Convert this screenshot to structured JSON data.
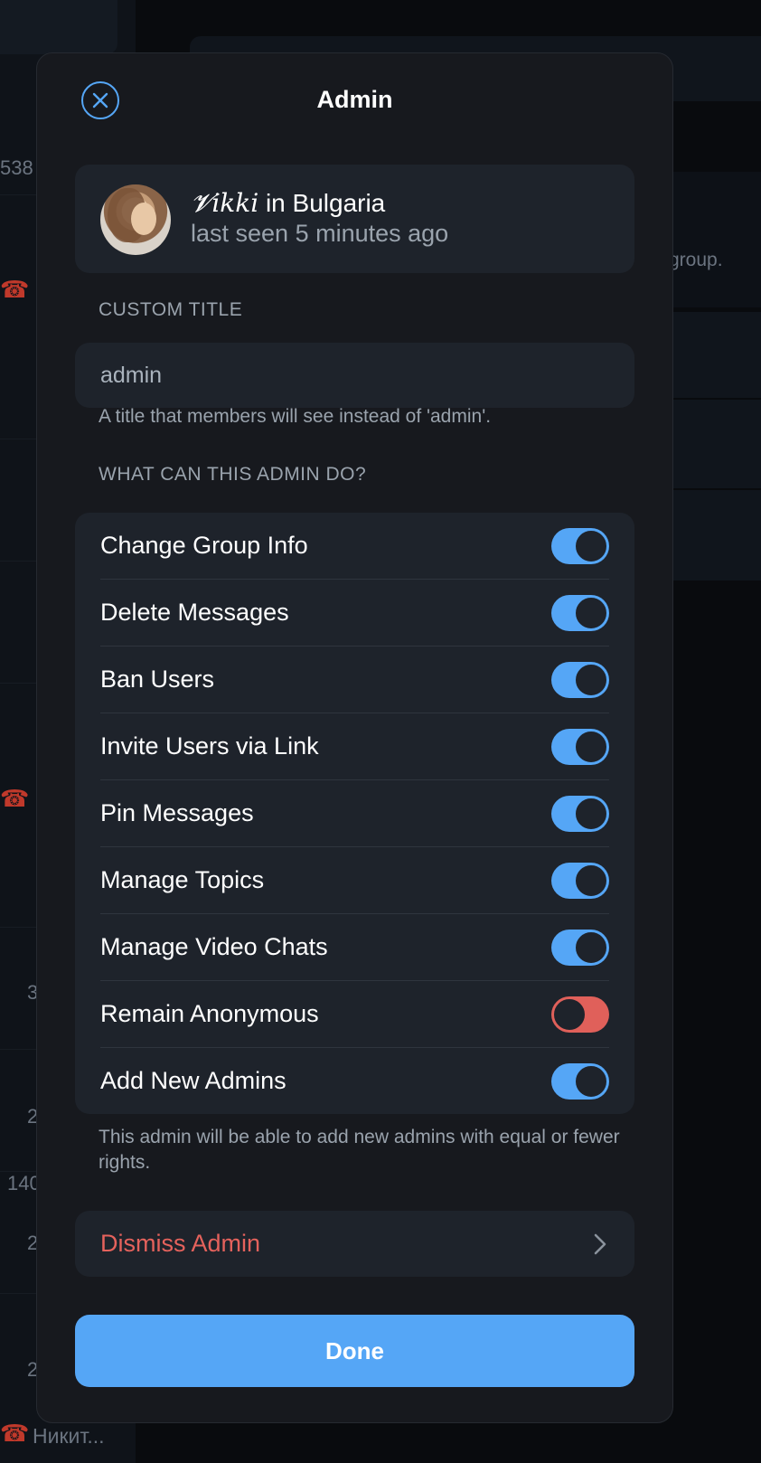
{
  "background": {
    "fragments": [
      "538",
      "group.",
      "3",
      "2",
      "140",
      "2",
      "2",
      "Никит..."
    ]
  },
  "modal": {
    "title": "Admin",
    "close_icon": "close-icon",
    "user": {
      "name_styled": "𝓥ikki",
      "name_suffix": " in Bulgaria",
      "status": "last seen 5 minutes ago"
    },
    "custom_title": {
      "label": "CUSTOM TITLE",
      "value": "admin",
      "helper": "A title that members will see instead of 'admin'."
    },
    "permissions": {
      "label": "WHAT CAN THIS ADMIN DO?",
      "items": [
        {
          "label": "Change Group Info",
          "enabled": true
        },
        {
          "label": "Delete Messages",
          "enabled": true
        },
        {
          "label": "Ban Users",
          "enabled": true
        },
        {
          "label": "Invite Users via Link",
          "enabled": true
        },
        {
          "label": "Pin Messages",
          "enabled": true
        },
        {
          "label": "Manage Topics",
          "enabled": true
        },
        {
          "label": "Manage Video Chats",
          "enabled": true
        },
        {
          "label": "Remain Anonymous",
          "enabled": false
        },
        {
          "label": "Add New Admins",
          "enabled": true
        }
      ],
      "helper": "This admin will be able to add new admins with equal or fewer rights."
    },
    "dismiss_label": "Dismiss Admin",
    "done_label": "Done"
  },
  "colors": {
    "accent": "#55a6f6",
    "danger": "#e5625c",
    "toggle_off": "#e0605a",
    "modal_bg": "#17191e",
    "card_bg": "#1e232b"
  }
}
